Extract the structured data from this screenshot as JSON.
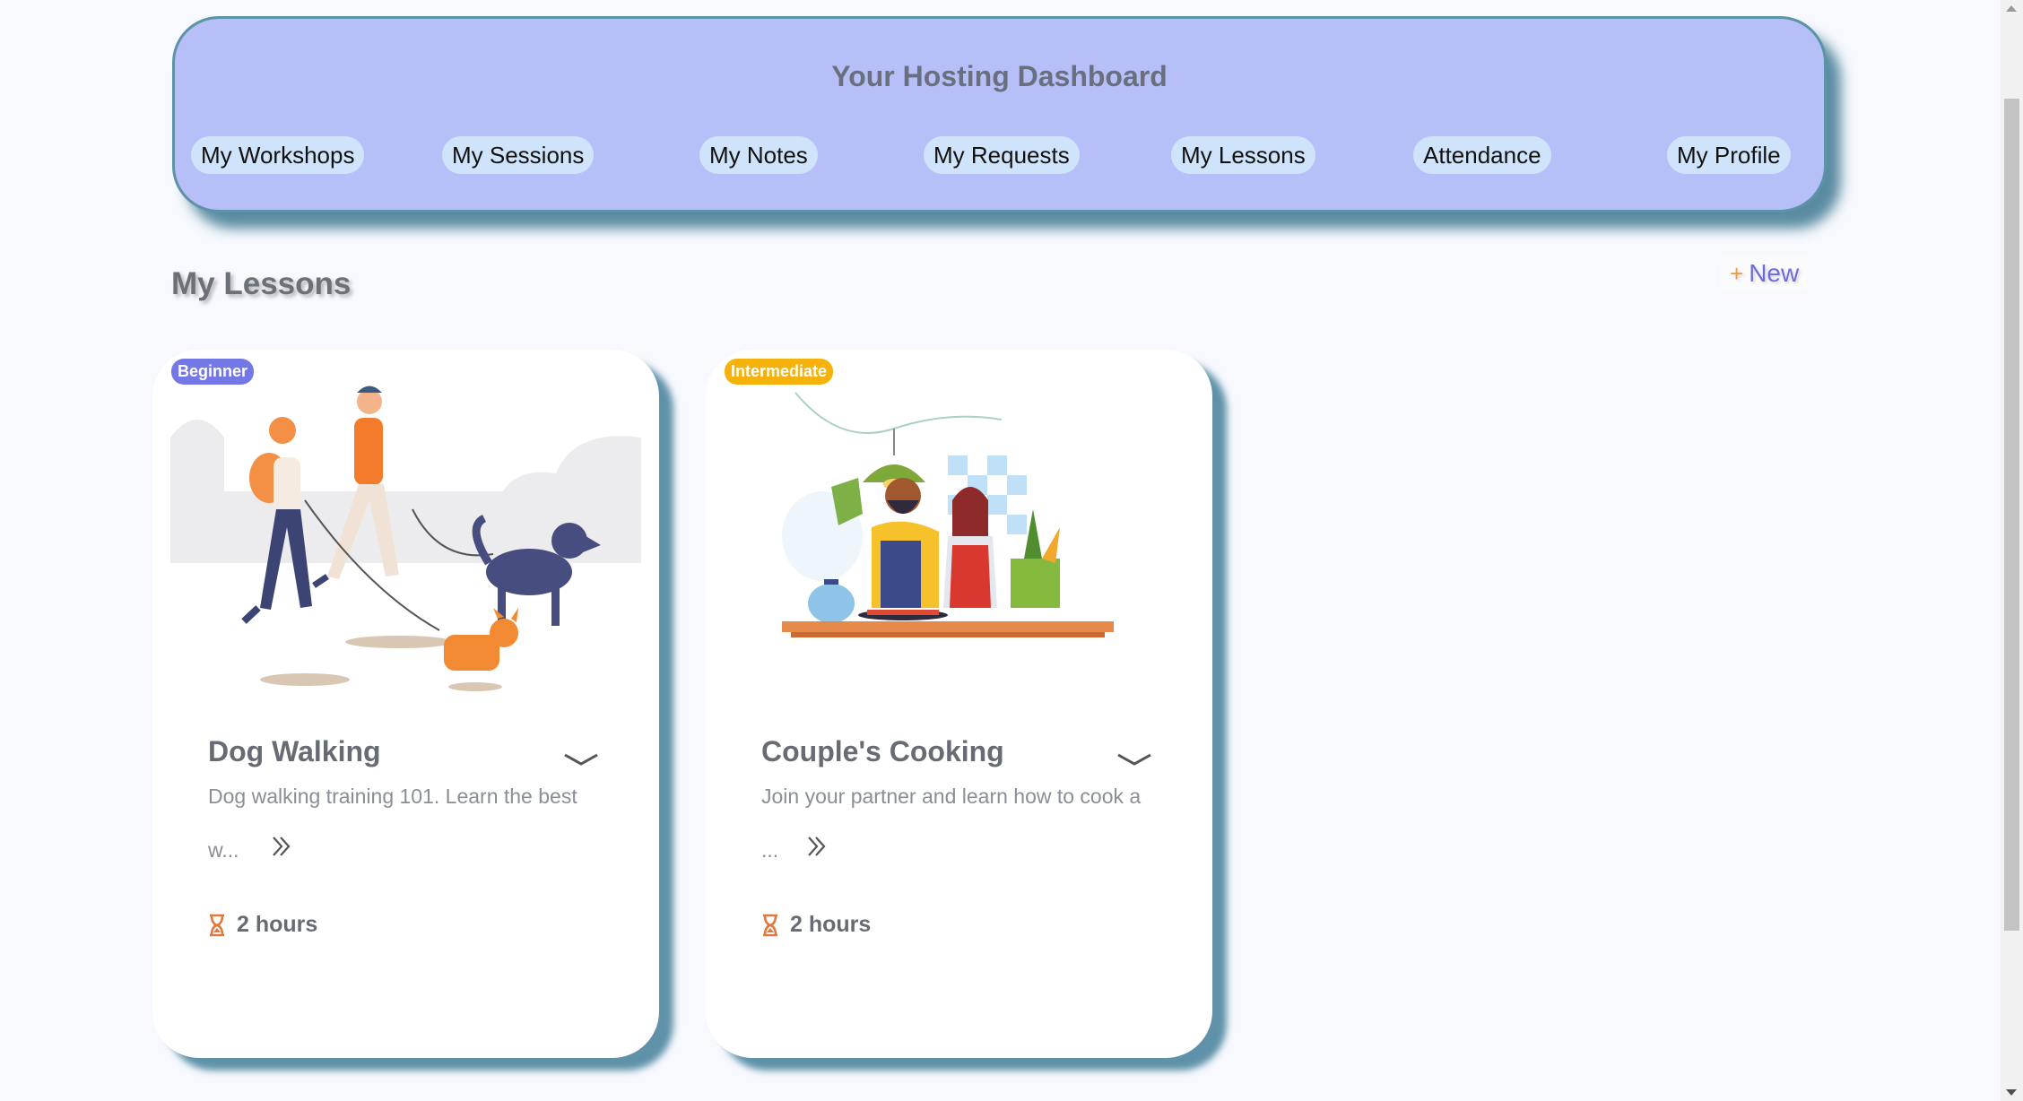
{
  "header": {
    "title": "Your Hosting Dashboard",
    "nav": [
      {
        "label": "My Workshops"
      },
      {
        "label": "My Sessions"
      },
      {
        "label": "My Notes"
      },
      {
        "label": "My Requests"
      },
      {
        "label": "My Lessons"
      },
      {
        "label": "Attendance"
      },
      {
        "label": "My Profile"
      }
    ]
  },
  "section": {
    "title": "My Lessons",
    "new_button_icon": "plus-icon",
    "new_button_label": "New"
  },
  "lessons": [
    {
      "badge": "Beginner",
      "badge_color": "#7478e6",
      "image": "dog-walking-illustration",
      "title": "Dog Walking",
      "description": "Dog walking training 101. Learn the best",
      "truncated": "w...",
      "duration": "2 hours"
    },
    {
      "badge": "Intermediate",
      "badge_color": "#f5b20a",
      "image": "couple-cooking-illustration",
      "title": "Couple's Cooking",
      "description": "Join your partner and learn how to cook a",
      "truncated": "...",
      "duration": "2 hours"
    }
  ],
  "colors": {
    "header_bg": "#b7bff8",
    "nav_pill_bg": "#cfe4fb",
    "card_shadow": "#4e869e",
    "hourglass": "#e07a3c"
  }
}
